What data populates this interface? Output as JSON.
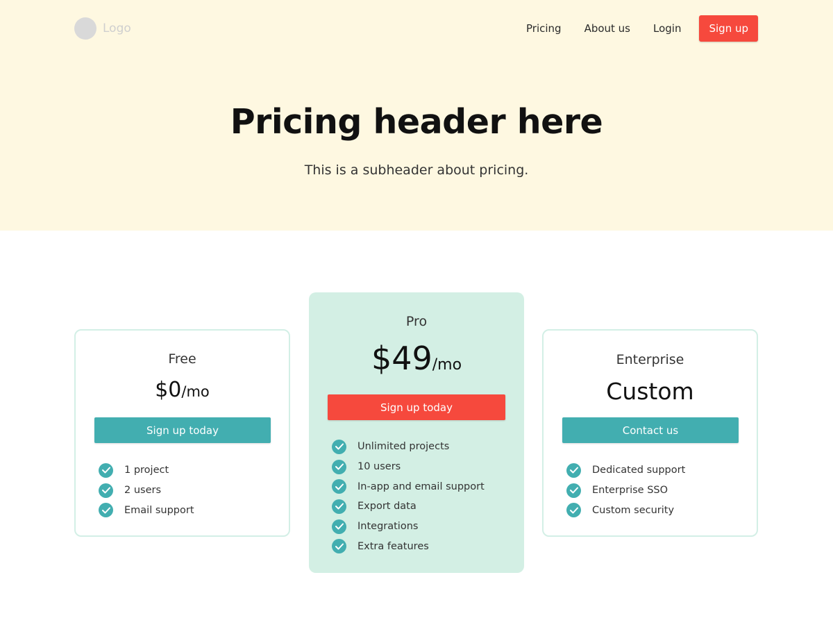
{
  "header": {
    "logo_label": "Logo",
    "nav": [
      "Pricing",
      "About us",
      "Login"
    ],
    "signup_label": "Sign up"
  },
  "hero": {
    "title": "Pricing header here",
    "subtitle": "This is a subheader about pricing."
  },
  "plans": [
    {
      "name": "Free",
      "price": "$0",
      "unit": "/mo",
      "cta": "Sign up today",
      "features": [
        "1 project",
        "2 users",
        "Email support"
      ]
    },
    {
      "name": "Pro",
      "price": "$49",
      "unit": "/mo",
      "cta": "Sign up today",
      "features": [
        "Unlimited projects",
        "10 users",
        "In-app and email support",
        "Export data",
        "Integrations",
        "Extra features"
      ]
    },
    {
      "name": "Enterprise",
      "price": "Custom",
      "cta": "Contact us",
      "features": [
        "Dedicated support",
        "Enterprise SSO",
        "Custom security"
      ]
    }
  ],
  "icons": {
    "check": "check-circle-icon",
    "logo": "logo-circle-icon"
  },
  "colors": {
    "hero_bg": "#fef8e1",
    "accent_red": "#f6493d",
    "teal": "#42aeb0",
    "pro_bg": "#d3efe4",
    "card_border": "#d3efe6"
  }
}
